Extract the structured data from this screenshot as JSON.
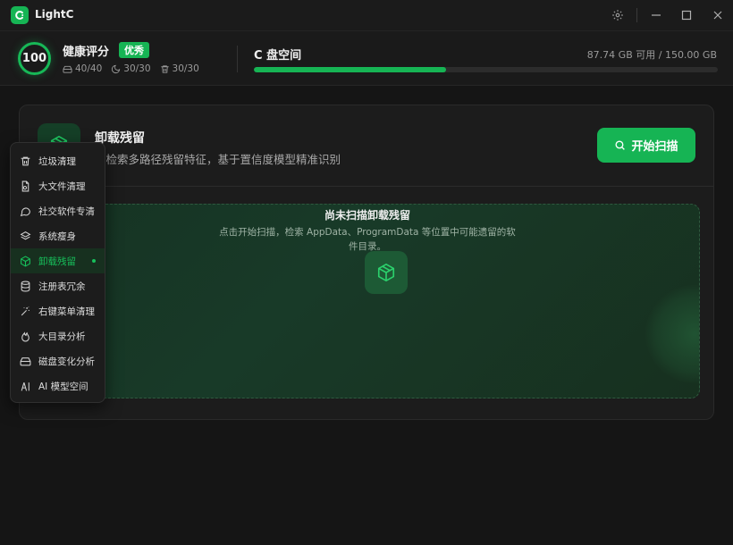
{
  "app": {
    "title": "LightC"
  },
  "health": {
    "score": "100",
    "title": "健康评分",
    "badge": "优秀",
    "stats": [
      "40/40",
      "30/30",
      "30/30"
    ]
  },
  "disk": {
    "title": "C 盘空间",
    "info": "87.74 GB 可用 / 150.00 GB",
    "used_fraction": 0.415
  },
  "card": {
    "title": "卸载残留",
    "description": "度检索多路径残留特征，基于置信度模型精准识别",
    "scan_label": "开始扫描",
    "empty_title": "尚未扫描卸载残留",
    "empty_desc": "点击开始扫描，检索 AppData、ProgramData 等位置中可能遗留的软件目录。"
  },
  "menu": {
    "items": [
      {
        "label": "垃圾清理",
        "icon": "trash-icon"
      },
      {
        "label": "大文件清理",
        "icon": "file-icon"
      },
      {
        "label": "社交软件专清",
        "icon": "chat-icon"
      },
      {
        "label": "系统瘦身",
        "icon": "layers-icon"
      },
      {
        "label": "卸载残留",
        "icon": "package-icon",
        "active": true
      },
      {
        "label": "注册表冗余",
        "icon": "database-icon"
      },
      {
        "label": "右键菜单清理",
        "icon": "wand-icon"
      },
      {
        "label": "大目录分析",
        "icon": "flame-icon"
      },
      {
        "label": "磁盘变化分析",
        "icon": "hard-drive-icon"
      },
      {
        "label": "AI 模型空间",
        "icon": "ai-icon"
      }
    ]
  },
  "colors": {
    "accent": "#16b454",
    "background": "#151515"
  }
}
